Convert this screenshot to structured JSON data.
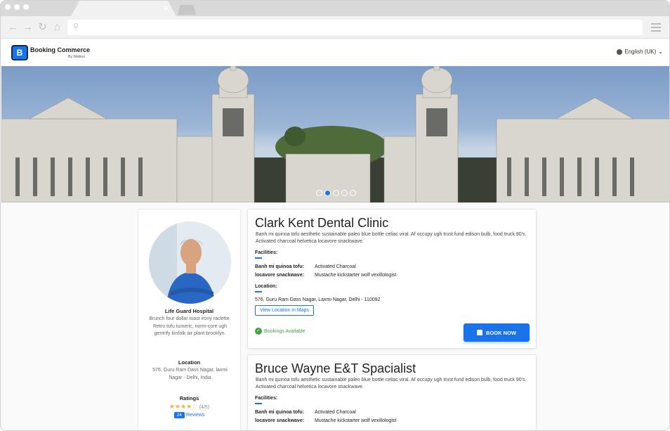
{
  "browser": {
    "close_tab": "×"
  },
  "header": {
    "logo_letter": "B",
    "logo_title": "Booking Commerce",
    "logo_sub": "By Webkul",
    "language": "English (UK)"
  },
  "slider": {
    "active_index": 1,
    "dot_count": 5
  },
  "profile": {
    "name": "Life Guard Hospital",
    "description": "Brunch four dollar toast irony raclette. Retro tofu tumeric, norm-core ugh gentrify kinfolk air plant brooklyn.",
    "location_title": "Location",
    "location": "576, Guru Ram Dass Nagar, laxmi Nagar - Delhi, India",
    "ratings_title": "Ratings",
    "stars_filled": "★★★★",
    "stars_empty": "☆",
    "rating_value": 4,
    "rating_max": 5,
    "rating_text": "(4/5)",
    "review_count": "24",
    "reviews_label": "Reviews"
  },
  "listings": [
    {
      "title": "Clark Kent Dental Clinic",
      "description": "Banh mi quinoa tofu aesthetic sustainable paleo blue bottle celiac viral. Af occupy ugh trust fund edison bulb, food truck 90's. Activated charcoal helvetica locavore snackwave.",
      "facilities_label": "Facilities:",
      "facilities": [
        {
          "key": "Banh mi quinoa tofu:",
          "value": "Activated Charcoal"
        },
        {
          "key": "locavore snackwave:",
          "value": "Mustache kickstarter wolf vexillologist"
        }
      ],
      "location_label": "Location:",
      "address": "576, Guru Ram Dass Nagar, Laxmi Nagar, Delhi - 110092",
      "map_button": "View Location in Maps",
      "availability": "Bookings Available",
      "book_button": "BOOK NOW"
    },
    {
      "title": "Bruce Wayne E&T Spacialist",
      "description": "Banh mi quinoa tofu aesthetic sustainable paleo blue bottle celiac viral. Af occupy ugh trust fund edison bulb, food truck 90's. Activated charcoal helvetica locavore snackwave.",
      "facilities_label": "Facilities:",
      "facilities": [
        {
          "key": "Banh mi quinoa tofu:",
          "value": "Activated Charcoal"
        },
        {
          "key": "locavore snackwave:",
          "value": "Mustache kickstarter wolf vexillologist"
        }
      ]
    }
  ],
  "colors": {
    "accent": "#1a73e8",
    "success": "#43a047",
    "star": "#f3b431"
  }
}
